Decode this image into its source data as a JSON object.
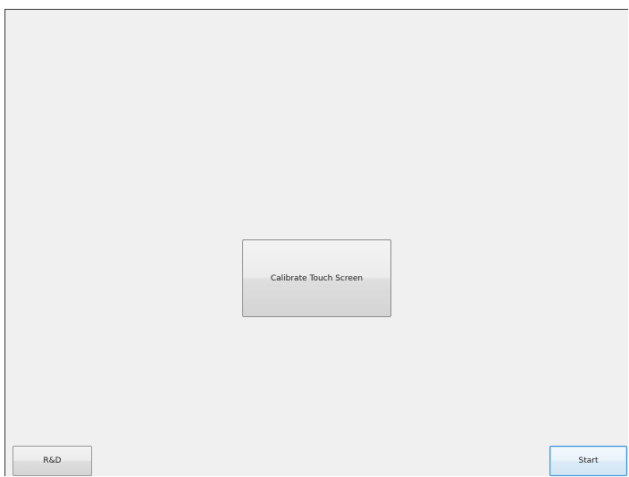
{
  "buttons": {
    "calibrate_label": "Calibrate Touch Screen",
    "rd_label": "R&D",
    "start_label": "Start"
  },
  "colors": {
    "background": "#f0f0f0",
    "focus_border": "#3c8fd0"
  }
}
